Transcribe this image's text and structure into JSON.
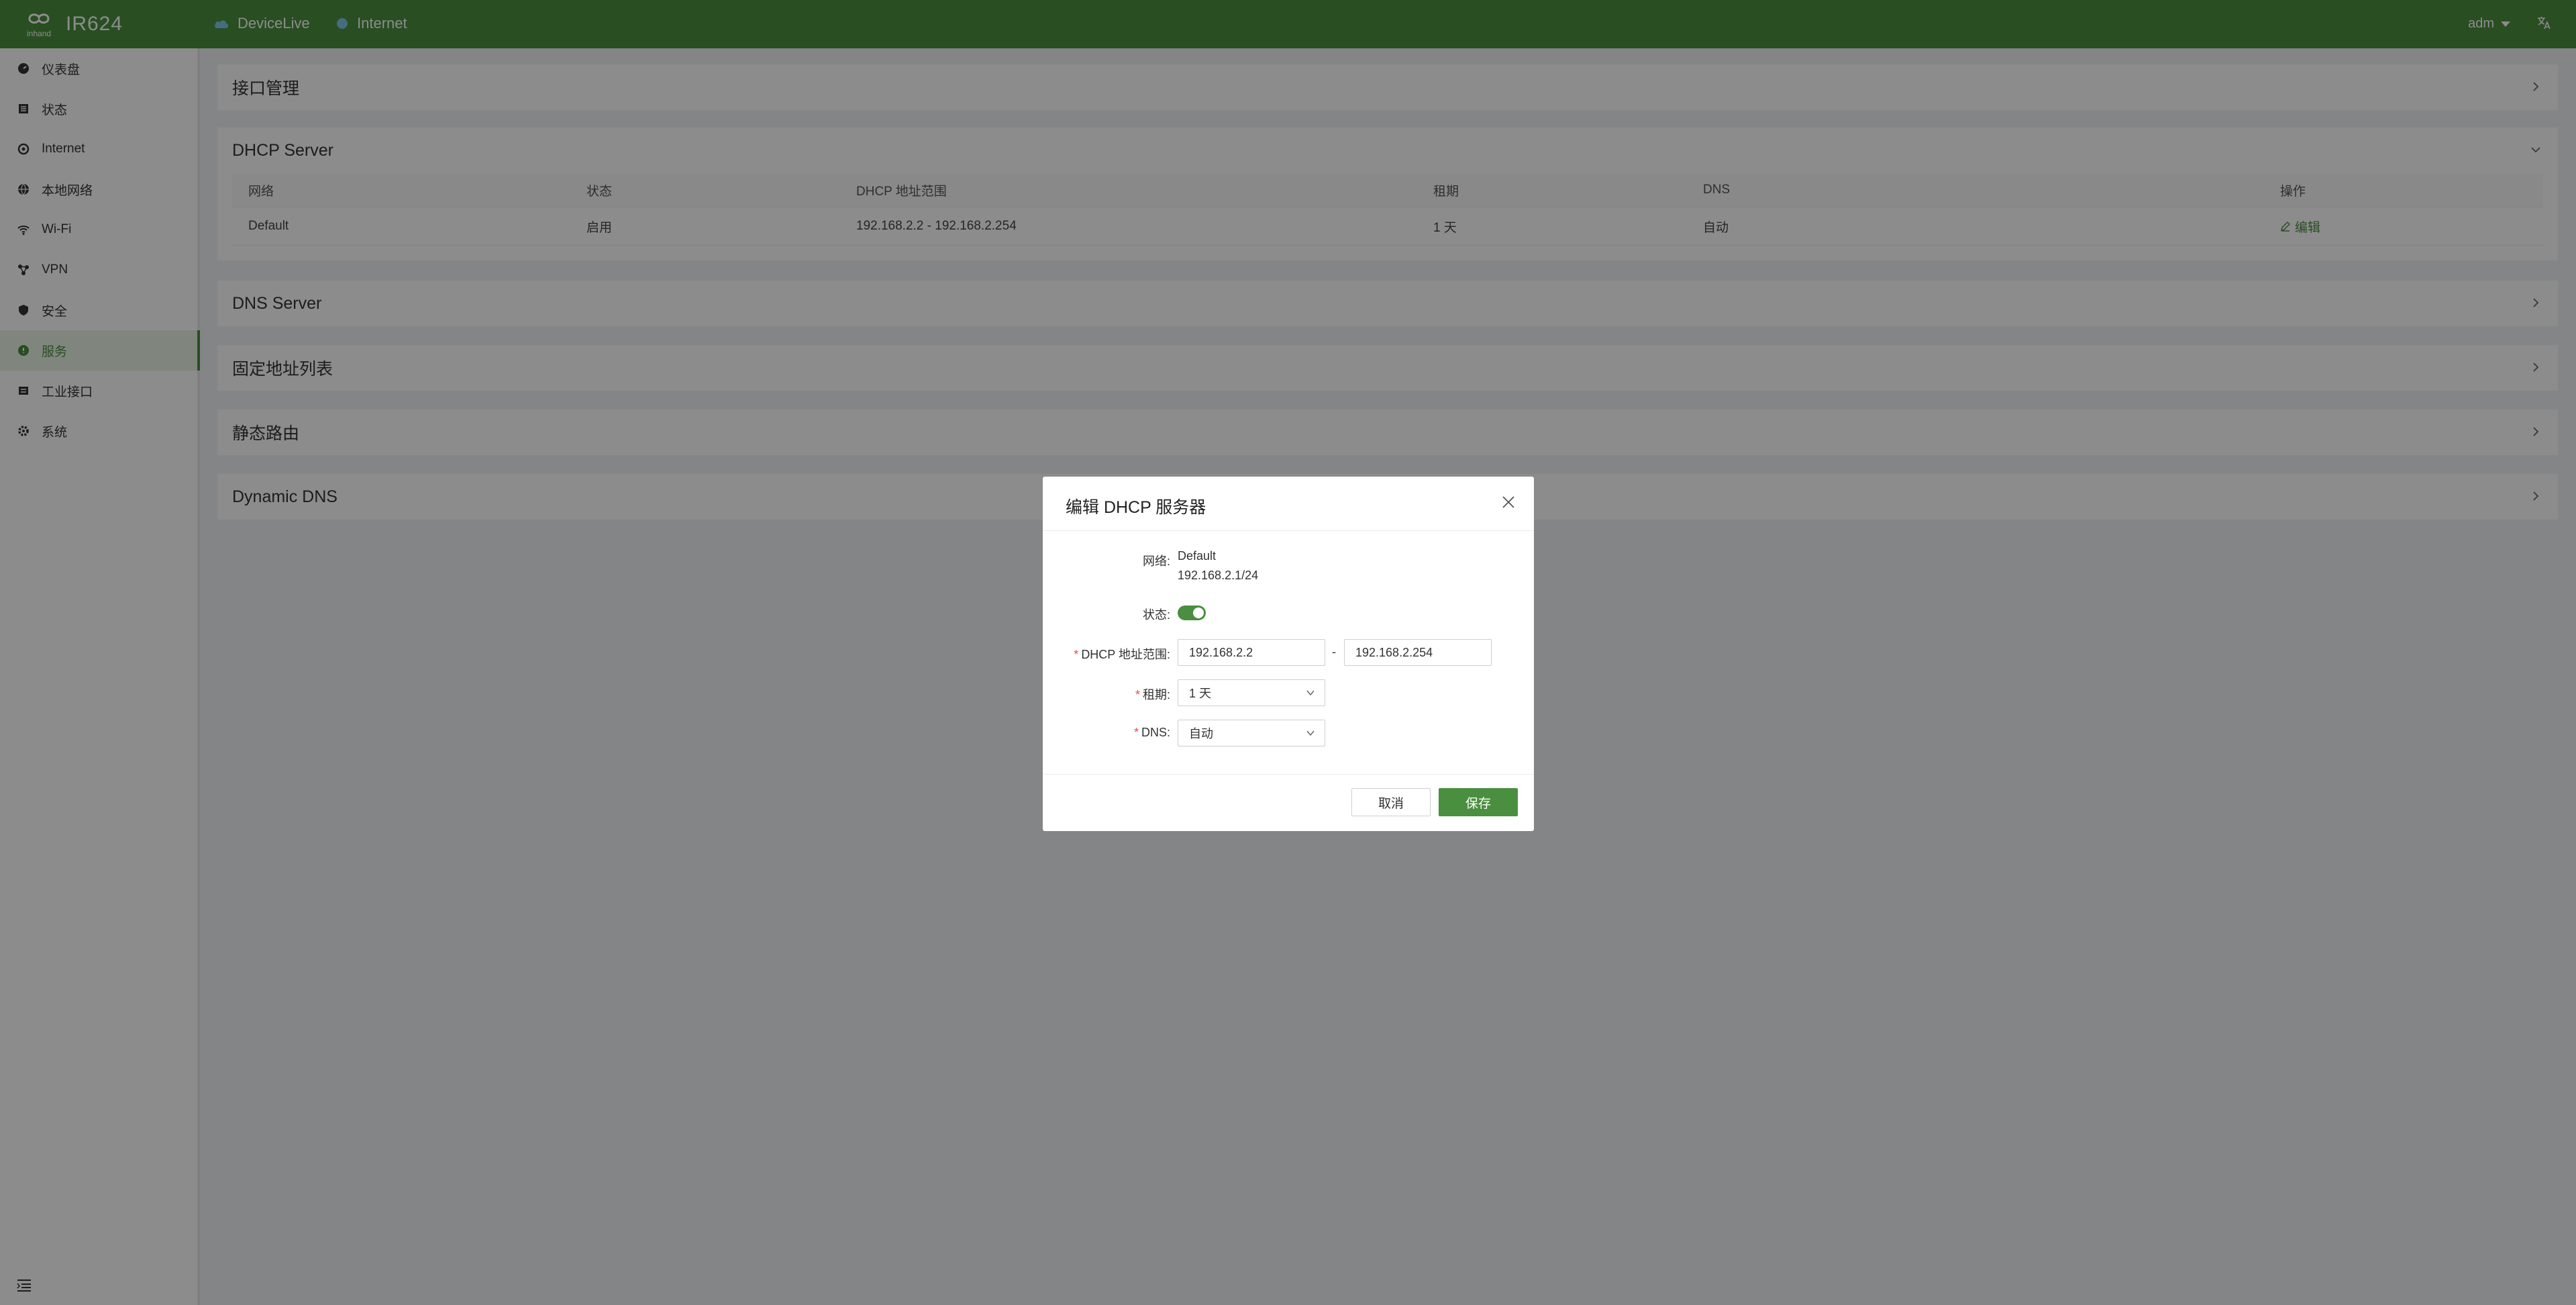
{
  "topbar": {
    "logo_text": "IR624",
    "status_items": [
      {
        "label": "DeviceLive",
        "icon": "cloud-icon"
      },
      {
        "label": "Internet",
        "icon": "dot-icon"
      }
    ],
    "user": "adm",
    "lang_icon": "translate-icon",
    "lang_glyph": "文A"
  },
  "sidebar": {
    "items": [
      {
        "label": "仪表盘",
        "icon": "dashboard-icon"
      },
      {
        "label": "状态",
        "icon": "status-icon"
      },
      {
        "label": "Internet",
        "icon": "internet-icon"
      },
      {
        "label": "本地网络",
        "icon": "local-network-icon"
      },
      {
        "label": "Wi-Fi",
        "icon": "wifi-icon"
      },
      {
        "label": "VPN",
        "icon": "vpn-icon"
      },
      {
        "label": "安全",
        "icon": "security-icon"
      },
      {
        "label": "服务",
        "icon": "service-icon",
        "active": true
      },
      {
        "label": "工业接口",
        "icon": "industrial-icon"
      },
      {
        "label": "系统",
        "icon": "system-icon"
      }
    ]
  },
  "main": {
    "panels": [
      {
        "title": "接口管理"
      },
      {
        "title": "DHCP Server"
      },
      {
        "title": "DNS Server"
      },
      {
        "title": "固定地址列表"
      },
      {
        "title": "静态路由"
      },
      {
        "title": "Dynamic DNS"
      }
    ],
    "dhcp_table": {
      "columns": [
        "网络",
        "状态",
        "DHCP 地址范围",
        "租期",
        "DNS",
        "操作"
      ],
      "rows": [
        {
          "network": "Default",
          "status": "启用",
          "range": "192.168.2.2 - 192.168.2.254",
          "lease": "1 天",
          "dns": "自动",
          "action": "编辑"
        }
      ]
    }
  },
  "modal": {
    "title": "编辑 DHCP 服务器",
    "network_label": "网络:",
    "network_name": "Default",
    "network_subnet": "192.168.2.1/24",
    "status_label": "状态:",
    "status_on": true,
    "range_label": "DHCP 地址范围:",
    "range_start": "192.168.2.2",
    "range_sep": "-",
    "range_end": "192.168.2.254",
    "lease_label": "租期:",
    "lease_value": "1 天",
    "dns_label": "DNS:",
    "dns_value": "自动",
    "required_mark": "*",
    "cancel_label": "取消",
    "save_label": "保存"
  },
  "colors": {
    "brand": "#4a8f3f",
    "required": "#e34d4d"
  }
}
